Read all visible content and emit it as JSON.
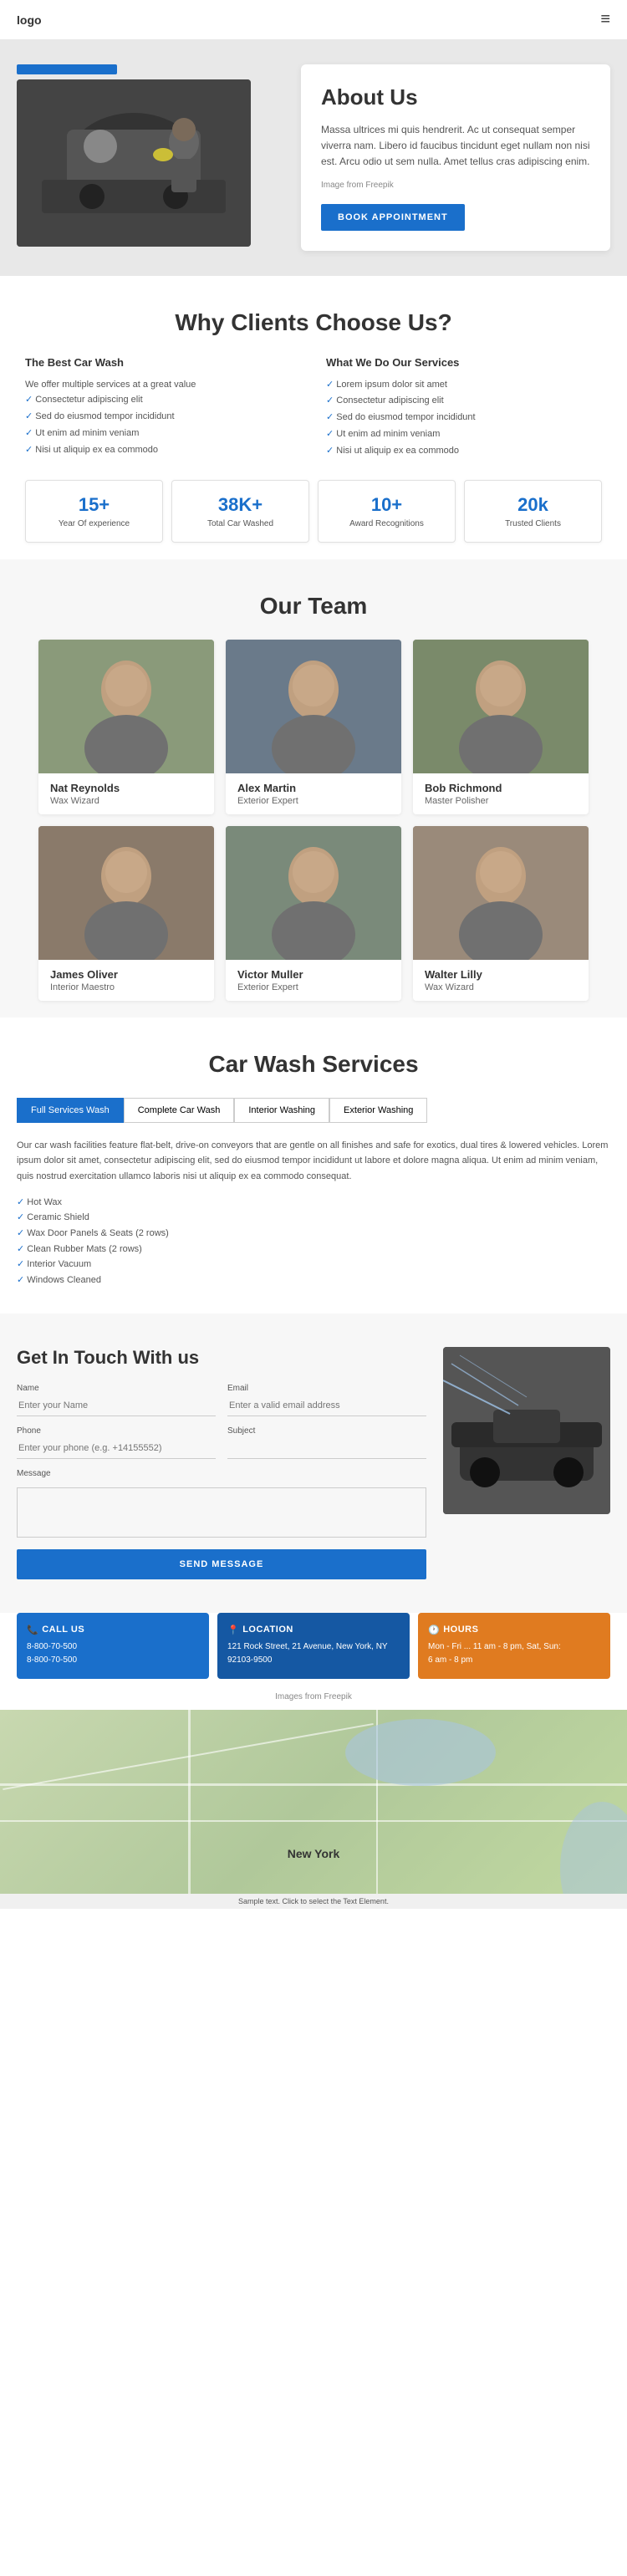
{
  "header": {
    "logo": "logo",
    "menu_icon": "≡"
  },
  "hero": {
    "about_title": "About Us",
    "about_body": "Massa ultrices mi quis hendrerit. Ac ut consequat semper viverra nam. Libero id faucibus tincidunt eget nullam non nisi est. Arcu odio ut sem nulla. Amet tellus cras adipiscing enim.",
    "image_credit": "Image from Freepik",
    "book_btn": "BOOK APPOINTMENT"
  },
  "why": {
    "section_title": "Why Clients Choose Us?",
    "col1_title": "The Best Car Wash",
    "col1_text": "We offer multiple services at a great value",
    "col1_list": [
      "Consectetur adipiscing elit",
      "Sed do eiusmod tempor incididunt",
      "Ut enim ad minim veniam",
      "Nisi ut aliquip ex ea commodo"
    ],
    "col2_title": "What We Do Our Services",
    "col2_list": [
      "Lorem ipsum dolor sit amet",
      "Consectetur adipiscing elit",
      "Sed do eiusmod tempor incididunt",
      "Ut enim ad minim veniam",
      "Nisi ut aliquip ex ea commodo"
    ],
    "stats": [
      {
        "num": "15+",
        "label": "Year Of experience"
      },
      {
        "num": "38K+",
        "label": "Total Car Washed"
      },
      {
        "num": "10+",
        "label": "Award Recognitions"
      },
      {
        "num": "20k",
        "label": "Trusted Clients"
      }
    ]
  },
  "team": {
    "section_title": "Our Team",
    "members": [
      {
        "name": "Nat Reynolds",
        "role": "Wax Wizard",
        "bg": "#8a9a7a"
      },
      {
        "name": "Alex Martin",
        "role": "Exterior Expert",
        "bg": "#6a7a8a"
      },
      {
        "name": "Bob Richmond",
        "role": "Master Polisher",
        "bg": "#7a8a6a"
      },
      {
        "name": "James Oliver",
        "role": "Interior Maestro",
        "bg": "#8a7a6a"
      },
      {
        "name": "Victor Muller",
        "role": "Exterior Expert",
        "bg": "#7a8a7a"
      },
      {
        "name": "Walter Lilly",
        "role": "Wax Wizard",
        "bg": "#9a8a7a"
      }
    ]
  },
  "services": {
    "section_title": "Car Wash Services",
    "tabs": [
      "Full Services Wash",
      "Complete Car Wash",
      "Interior Washing",
      "Exterior Washing"
    ],
    "active_tab": 0,
    "content_para": "Our car wash facilities feature flat-belt, drive-on conveyors that are gentle on all finishes and safe for exotics, dual tires & lowered vehicles. Lorem ipsum dolor sit amet, consectetur adipiscing elit, sed do eiusmod tempor incididunt ut labore et dolore magna aliqua. Ut enim ad minim veniam, quis nostrud exercitation ullamco laboris nisi ut aliquip ex ea commodo consequat.",
    "list_items": [
      "Hot Wax",
      "Ceramic Shield",
      "Wax Door Panels & Seats (2 rows)",
      "Clean Rubber Mats (2 rows)",
      "Interior Vacuum",
      "Windows Cleaned"
    ]
  },
  "contact": {
    "section_title": "Get In Touch With us",
    "fields": {
      "name_label": "Name",
      "name_placeholder": "Enter your Name",
      "email_label": "Email",
      "email_placeholder": "Enter a valid email address",
      "phone_label": "Phone",
      "phone_placeholder": "Enter your phone (e.g. +14155552)",
      "subject_label": "Subject",
      "subject_placeholder": "",
      "message_label": "Message"
    },
    "send_btn": "SEND MESSAGE"
  },
  "info_boxes": [
    {
      "type": "blue",
      "icon": "📞",
      "title": "CALL US",
      "lines": [
        "8-800-70-500",
        "8-800-70-500"
      ]
    },
    {
      "type": "dark-blue",
      "icon": "📍",
      "title": "LOCATION",
      "lines": [
        "121 Rock Street, 21 Avenue, New York, NY 92103-9500"
      ]
    },
    {
      "type": "orange",
      "icon": "🕐",
      "title": "HOURS",
      "lines": [
        "Mon - Fri ... 11 am - 8 pm, Sat, Sun:",
        "6 am - 8 pm"
      ]
    }
  ],
  "images_credit": "Images from Freepik",
  "map": {
    "label": "New York",
    "sample_text": "Sample text. Click to select the Text Element."
  }
}
